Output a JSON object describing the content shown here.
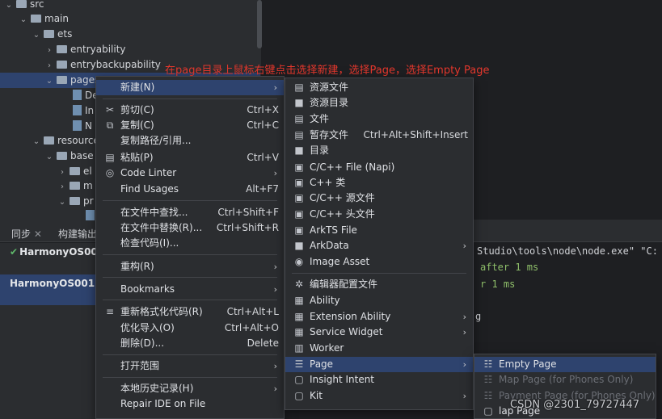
{
  "tree": {
    "items": [
      {
        "label": "src",
        "chev": "⌄",
        "kind": "folder"
      },
      {
        "label": "main",
        "chev": "⌄",
        "kind": "folder"
      },
      {
        "label": "ets",
        "chev": "⌄",
        "kind": "folder"
      },
      {
        "label": "entryability",
        "chev": "›",
        "kind": "folder"
      },
      {
        "label": "entrybackupability",
        "chev": "›",
        "kind": "folder"
      },
      {
        "label": "pages",
        "chev": "⌄",
        "kind": "folder"
      },
      {
        "label": "De",
        "chev": "",
        "kind": "file"
      },
      {
        "label": "In",
        "chev": "",
        "kind": "file"
      },
      {
        "label": "N",
        "chev": "",
        "kind": "file"
      },
      {
        "label": "resources",
        "chev": "⌄",
        "kind": "folder"
      },
      {
        "label": "base",
        "chev": "⌄",
        "kind": "folder"
      },
      {
        "label": "el",
        "chev": "›",
        "kind": "folder"
      },
      {
        "label": "m",
        "chev": "›",
        "kind": "folder"
      },
      {
        "label": "pr",
        "chev": "⌄",
        "kind": "folder"
      }
    ]
  },
  "annotation": "在page目录上鼠标右键点击选择新建，选择Page，选择Empty Page",
  "bottom": {
    "tabs": [
      "同步",
      "构建输出"
    ],
    "runs": [
      "HarmonyOS001 [O",
      "HarmonyOS001 [b"
    ],
    "console": [
      "Studio\\tools\\node\\node.exe\" \"C:",
      "after 1 ms",
      "r 1 ms",
      "g"
    ]
  },
  "context_menu": {
    "items": [
      {
        "icon": "",
        "label": "新建(N)",
        "shortcut": "",
        "arrow": "›"
      },
      {
        "icon": "✂",
        "label": "剪切(C)",
        "shortcut": "Ctrl+X",
        "arrow": ""
      },
      {
        "icon": "⧉",
        "label": "复制(C)",
        "shortcut": "Ctrl+C",
        "arrow": ""
      },
      {
        "icon": "",
        "label": "复制路径/引用...",
        "shortcut": "",
        "arrow": ""
      },
      {
        "icon": "▤",
        "label": "粘贴(P)",
        "shortcut": "Ctrl+V",
        "arrow": ""
      },
      {
        "icon": "◎",
        "label": "Code Linter",
        "shortcut": "",
        "arrow": "›"
      },
      {
        "icon": "",
        "label": "Find Usages",
        "shortcut": "Alt+F7",
        "arrow": ""
      },
      {
        "icon": "",
        "label": "在文件中查找...",
        "shortcut": "Ctrl+Shift+F",
        "arrow": ""
      },
      {
        "icon": "",
        "label": "在文件中替换(R)...",
        "shortcut": "Ctrl+Shift+R",
        "arrow": ""
      },
      {
        "icon": "",
        "label": "检查代码(I)...",
        "shortcut": "",
        "arrow": ""
      },
      {
        "icon": "",
        "label": "重构(R)",
        "shortcut": "",
        "arrow": "›"
      },
      {
        "icon": "",
        "label": "Bookmarks",
        "shortcut": "",
        "arrow": "›"
      },
      {
        "icon": "≡",
        "label": "重新格式化代码(R)",
        "shortcut": "Ctrl+Alt+L",
        "arrow": ""
      },
      {
        "icon": "",
        "label": "优化导入(O)",
        "shortcut": "Ctrl+Alt+O",
        "arrow": ""
      },
      {
        "icon": "",
        "label": "删除(D)...",
        "shortcut": "Delete",
        "arrow": ""
      },
      {
        "icon": "",
        "label": "打开范围",
        "shortcut": "",
        "arrow": "›"
      },
      {
        "icon": "",
        "label": "本地历史记录(H)",
        "shortcut": "",
        "arrow": "›"
      },
      {
        "icon": "",
        "label": "Repair IDE on File",
        "shortcut": "",
        "arrow": ""
      }
    ]
  },
  "new_menu": {
    "items": [
      {
        "icon": "▤",
        "label": "资源文件",
        "shortcut": "",
        "arrow": ""
      },
      {
        "icon": "■",
        "label": "资源目录",
        "shortcut": "",
        "arrow": ""
      },
      {
        "icon": "▤",
        "label": "文件",
        "shortcut": "",
        "arrow": ""
      },
      {
        "icon": "▤",
        "label": "暂存文件",
        "shortcut": "Ctrl+Alt+Shift+Insert",
        "arrow": ""
      },
      {
        "icon": "■",
        "label": "目录",
        "shortcut": "",
        "arrow": ""
      },
      {
        "icon": "▣",
        "label": "C/C++ File (Napi)",
        "shortcut": "",
        "arrow": ""
      },
      {
        "icon": "▣",
        "label": "C++ 类",
        "shortcut": "",
        "arrow": ""
      },
      {
        "icon": "▣",
        "label": "C/C++ 源文件",
        "shortcut": "",
        "arrow": ""
      },
      {
        "icon": "▣",
        "label": "C/C++ 头文件",
        "shortcut": "",
        "arrow": ""
      },
      {
        "icon": "▣",
        "label": "ArkTS File",
        "shortcut": "",
        "arrow": ""
      },
      {
        "icon": "■",
        "label": "ArkData",
        "shortcut": "",
        "arrow": "›"
      },
      {
        "icon": "◉",
        "label": "Image Asset",
        "shortcut": "",
        "arrow": ""
      },
      {
        "icon": "✲",
        "label": "编辑器配置文件",
        "shortcut": "",
        "arrow": ""
      },
      {
        "icon": "▦",
        "label": "Ability",
        "shortcut": "",
        "arrow": ""
      },
      {
        "icon": "▦",
        "label": "Extension Ability",
        "shortcut": "",
        "arrow": "›"
      },
      {
        "icon": "▦",
        "label": "Service Widget",
        "shortcut": "",
        "arrow": "›"
      },
      {
        "icon": "▥",
        "label": "Worker",
        "shortcut": "",
        "arrow": ""
      },
      {
        "icon": "☰",
        "label": "Page",
        "shortcut": "",
        "arrow": "›"
      },
      {
        "icon": "▢",
        "label": "Insight Intent",
        "shortcut": "",
        "arrow": ""
      },
      {
        "icon": "▢",
        "label": "Kit",
        "shortcut": "",
        "arrow": "›"
      }
    ]
  },
  "page_menu": {
    "items": [
      {
        "icon": "☷",
        "label": "Empty Page"
      },
      {
        "icon": "☷",
        "label": "Map Page (for Phones Only)"
      },
      {
        "icon": "☷",
        "label": "Payment Page (for Phones Only)"
      },
      {
        "icon": "▢",
        "label": "lap Page"
      }
    ]
  },
  "watermark": "CSDN @2301_79727447"
}
